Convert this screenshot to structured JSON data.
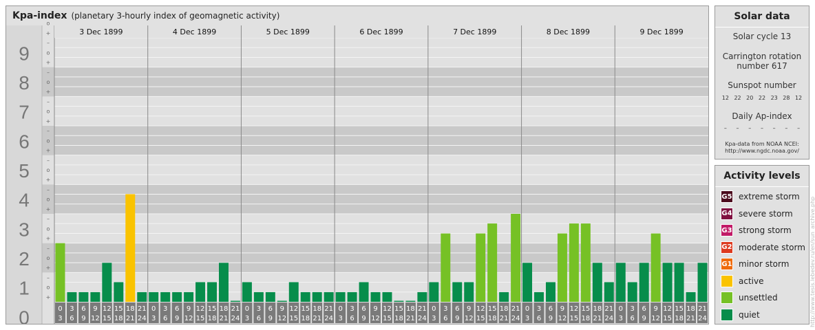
{
  "header": {
    "title": "Kpa-index",
    "subtitle": "(planetary 3-hourly index of geomagnetic activity)"
  },
  "chart_data": {
    "type": "bar",
    "ylim": [
      0,
      9
    ],
    "y_ticks": [
      "0",
      "1",
      "2",
      "3",
      "4",
      "5",
      "6",
      "7",
      "8",
      "9"
    ],
    "y_minor_labels": [
      "+",
      "o",
      "–"
    ],
    "days": [
      "3 Dec 1899",
      "4 Dec 1899",
      "5 Dec 1899",
      "6 Dec 1899",
      "7 Dec 1899",
      "8 Dec 1899",
      "9 Dec 1899"
    ],
    "interval_starts": [
      "0",
      "3",
      "6",
      "9",
      "12",
      "15",
      "18",
      "21"
    ],
    "interval_ends": [
      "3",
      "6",
      "9",
      "12",
      "15",
      "18",
      "21",
      "24"
    ],
    "series": [
      {
        "values": [
          2.0,
          0.33,
          0.33,
          0.33,
          1.33,
          0.67,
          3.67,
          0.33,
          0.33,
          0.33,
          0.33,
          0.33,
          0.67,
          0.67,
          1.33,
          0.0,
          0.67,
          0.33,
          0.33,
          0.0,
          0.67,
          0.33,
          0.33,
          0.33,
          0.33,
          0.33,
          0.67,
          0.33,
          0.33,
          0.0,
          0.0,
          0.33,
          0.67,
          2.33,
          0.67,
          0.67,
          2.33,
          2.67,
          0.33,
          3.0,
          1.33,
          0.33,
          0.67,
          2.33,
          2.67,
          2.67,
          1.33,
          0.67,
          1.33,
          0.67,
          1.33,
          2.33,
          1.33,
          1.33,
          0.33,
          1.33
        ]
      }
    ],
    "colors": {
      "quiet": "#078d4b",
      "unsettled": "#76c125",
      "active": "#fac300"
    }
  },
  "solar_data": {
    "heading": "Solar data",
    "solar_cycle": "Solar cycle 13",
    "carrington_line1": "Carrington rotation",
    "carrington_line2": "number 617",
    "sunspot_label": "Sunspot number",
    "sunspot_values": [
      "12",
      "22",
      "20",
      "22",
      "23",
      "28",
      "12"
    ],
    "ap_label": "Daily Ap-index",
    "ap_values": [
      "–",
      "–",
      "–",
      "–",
      "–",
      "–",
      "–"
    ],
    "source_line1": "Kpa-data from NOAA NCEI:",
    "source_line2": "http://www.ngdc.noaa.gov/"
  },
  "activity_levels": {
    "heading": "Activity levels",
    "items": [
      {
        "badge": "G5",
        "label": "extreme storm",
        "color": "#4b0a1c"
      },
      {
        "badge": "G4",
        "label": "severe storm",
        "color": "#801040"
      },
      {
        "badge": "G3",
        "label": "strong storm",
        "color": "#c11a67"
      },
      {
        "badge": "G2",
        "label": "moderate storm",
        "color": "#dd3a1f"
      },
      {
        "badge": "G1",
        "label": "minor storm",
        "color": "#ef6b0c"
      },
      {
        "badge": "",
        "label": "active",
        "color": "#fac300"
      },
      {
        "badge": "",
        "label": "unsettled",
        "color": "#76c125"
      },
      {
        "badge": "",
        "label": "quiet",
        "color": "#078d4b"
      }
    ]
  },
  "credit": "http://www.tesis.lebedev.ru/en/sun_archive.php"
}
